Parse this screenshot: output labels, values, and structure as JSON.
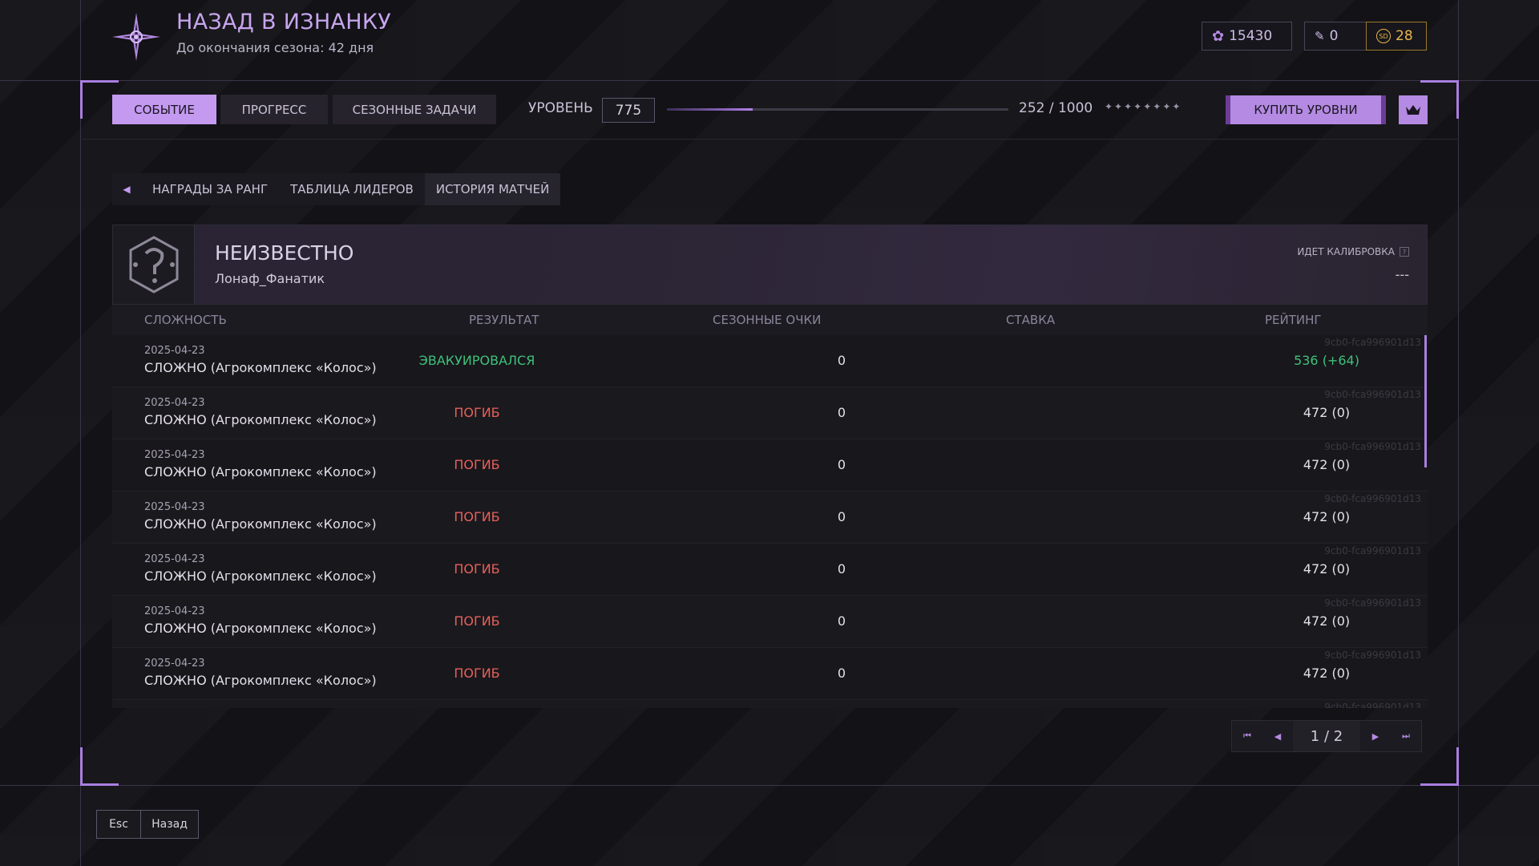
{
  "header": {
    "title": "НАЗАД В ИЗНАНКУ",
    "subtitle": "До окончания сезона: 42 дня",
    "currencies": [
      {
        "icon": "flower-currency-icon",
        "value": "15430"
      },
      {
        "icon": "ticket-icon",
        "value": "0"
      },
      {
        "icon": "sd-coin-icon",
        "value": "28",
        "color": "#e9b64a"
      }
    ]
  },
  "nav": {
    "tabs": [
      {
        "label": "СОБЫТИЕ",
        "active": true
      },
      {
        "label": "ПРОГРЕСС",
        "active": false
      },
      {
        "label": "СЕЗОННЫЕ ЗАДАЧИ",
        "active": false
      }
    ],
    "level_label": "УРОВЕНЬ",
    "level_value": "775",
    "progress_text": "252 / 1000",
    "progress_fraction": 0.252,
    "buy_label": "КУПИТЬ УРОВНИ"
  },
  "subtabs": [
    {
      "label": "НАГРАДЫ ЗА РАНГ",
      "active": false
    },
    {
      "label": "ТАБЛИЦА ЛИДЕРОВ",
      "active": false
    },
    {
      "label": "ИСТОРИЯ МАТЧЕЙ",
      "active": true
    }
  ],
  "profile": {
    "rank": "НЕИЗВЕСТНО",
    "player": "Лонаф_Фанатик",
    "calibration_label": "ИДЕТ КАЛИБРОВКА",
    "calibration_value": "---"
  },
  "table": {
    "headers": {
      "difficulty": "СЛОЖНОСТЬ",
      "result": "РЕЗУЛЬТАТ",
      "points": "СЕЗОННЫЕ ОЧКИ",
      "bet": "СТАВКА",
      "rating": "РЕЙТИНГ"
    },
    "rows": [
      {
        "date": "2025-04-23",
        "mode": "СЛОЖНО (Агрокомплекс «Колос»)",
        "result": "ЭВАКУИРОВАЛСЯ",
        "points": "0",
        "rating": "536 (+64)",
        "id": "9cb0-fca996901d13"
      },
      {
        "date": "2025-04-23",
        "mode": "СЛОЖНО (Агрокомплекс «Колос»)",
        "result": "ПОГИБ",
        "points": "0",
        "rating": "472 (0)",
        "id": "9cb0-fca996901d13"
      },
      {
        "date": "2025-04-23",
        "mode": "СЛОЖНО (Агрокомплекс «Колос»)",
        "result": "ПОГИБ",
        "points": "0",
        "rating": "472 (0)",
        "id": "9cb0-fca996901d13"
      },
      {
        "date": "2025-04-23",
        "mode": "СЛОЖНО (Агрокомплекс «Колос»)",
        "result": "ПОГИБ",
        "points": "0",
        "rating": "472 (0)",
        "id": "9cb0-fca996901d13"
      },
      {
        "date": "2025-04-23",
        "mode": "СЛОЖНО (Агрокомплекс «Колос»)",
        "result": "ПОГИБ",
        "points": "0",
        "rating": "472 (0)",
        "id": "9cb0-fca996901d13"
      },
      {
        "date": "2025-04-23",
        "mode": "СЛОЖНО (Агрокомплекс «Колос»)",
        "result": "ПОГИБ",
        "points": "0",
        "rating": "472 (0)",
        "id": "9cb0-fca996901d13"
      },
      {
        "date": "2025-04-23",
        "mode": "СЛОЖНО (Агрокомплекс «Колос»)",
        "result": "ПОГИБ",
        "points": "0",
        "rating": "472 (0)",
        "id": "9cb0-fca996901d13"
      },
      {
        "date": "",
        "mode": "",
        "result": "",
        "points": "",
        "rating": "",
        "id": "9cb0-fca996901d13"
      }
    ]
  },
  "pagination": {
    "text": "1 / 2"
  },
  "footer": {
    "key": "Esc",
    "label": "Назад"
  },
  "colors": {
    "accent": "#c49af0",
    "success": "#3fc07a",
    "danger": "#e8605a",
    "gold": "#e9b64a"
  }
}
